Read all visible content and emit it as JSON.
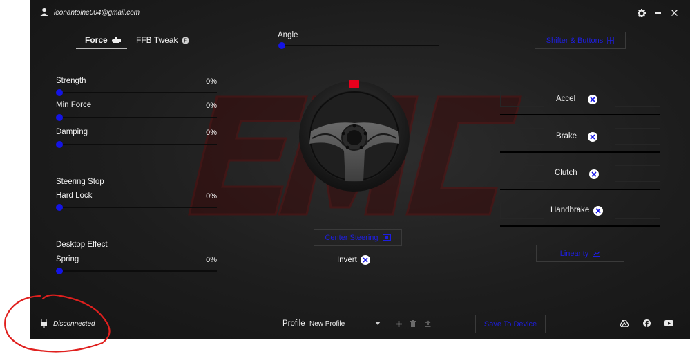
{
  "header": {
    "email": "leonantoine004@gmail.com",
    "icons": [
      "user-icon",
      "gear-icon",
      "minimize-icon",
      "close-icon"
    ]
  },
  "tabs": [
    {
      "label": "Force",
      "active": true,
      "icon": "motor-icon"
    },
    {
      "label": "FFB Tweak",
      "active": false,
      "icon": "f-badge-icon"
    }
  ],
  "force": {
    "strength": {
      "label": "Strength",
      "value": "0%"
    },
    "min_force": {
      "label": "Min Force",
      "value": "0%"
    },
    "damping": {
      "label": "Damping",
      "value": "0%"
    },
    "steering_stop_label": "Steering Stop",
    "hard_lock": {
      "label": "Hard Lock",
      "value": "0%"
    },
    "desktop_effect_label": "Desktop Effect",
    "spring": {
      "label": "Spring",
      "value": "0%"
    }
  },
  "angle": {
    "label": "Angle",
    "level": 0
  },
  "center_steering_label": "Center Steering",
  "invert_label": "Invert",
  "shifter_buttons_label": "Shifter & Buttons",
  "pedals": [
    {
      "label": "Accel"
    },
    {
      "label": "Brake"
    },
    {
      "label": "Clutch"
    },
    {
      "label": "Handbrake"
    }
  ],
  "linearity_label": "Linearity",
  "footer": {
    "status": "Disconnected",
    "profile_label": "Profile",
    "profile_value": "New Profile",
    "save_label": "Save To Device",
    "social_icons": [
      "drive-icon",
      "facebook-icon",
      "youtube-icon"
    ]
  },
  "colors": {
    "accent": "#1414e6",
    "wheel_marker": "#e8001c",
    "annotation": "#e0201e"
  }
}
